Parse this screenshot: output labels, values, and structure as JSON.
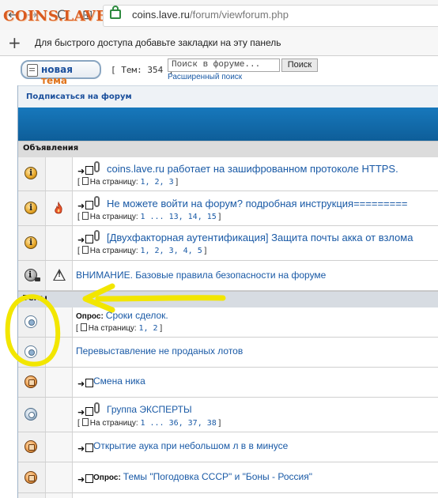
{
  "browser": {
    "back_symbol": "←",
    "forward_symbol": "→",
    "reload_symbol": "C",
    "apps_symbol": "⊞",
    "logo_overlay": "COINS.LAVE.RU",
    "url_host": "coins.lave.ru",
    "url_path": "/forum/viewforum.php",
    "bookmarks_hint": "Для быстрого доступа добавьте закладки на эту панель",
    "plus_symbol": "+"
  },
  "toolbar": {
    "new_topic_prefix": "новая ",
    "new_topic_accent": "тема",
    "topics_count": "[ Тем: 354 ]",
    "search_placeholder": "Поиск в форуме...",
    "search_button": "Поиск",
    "advanced_search": "Расширенный поиск"
  },
  "forum": {
    "subscribe": "Подписаться на форум",
    "announcements_header": "Объявления",
    "topics_header": "Темы"
  },
  "announcements": [
    {
      "title": "coins.lave.ru работает на зашифрованном протоколе HTTPS.",
      "pages_label": "На страницу:",
      "pages": "1, 2, 3"
    },
    {
      "title": "Не можете войти на форум? подробная инструкция=========",
      "pages_label": "На страницу:",
      "pages": "1 ... 13, 14, 15"
    },
    {
      "title": "[Двухфакторная аутентификация] Защита почты акка от взлома",
      "pages_label": "На страницу:",
      "pages": "1, 2, 3, 4, 5"
    },
    {
      "title": "ВНИМАНИЕ. Базовые правила безопасности на форуме"
    }
  ],
  "topics": [
    {
      "poll_label": "Опрос:",
      "title": "Сроки сделок.",
      "pages_label": "На страницу:",
      "pages": "1, 2"
    },
    {
      "title": "Перевыставление не проданых лотов"
    },
    {
      "title": "Смена ника"
    },
    {
      "title": "Группа ЭКСПЕРТЫ",
      "pages_label": "На страницу:",
      "pages": "1 ... 36, 37, 38"
    },
    {
      "title": "Открытие аука при небольшом л в в минусе"
    },
    {
      "poll_label": "Опрос:",
      "title": "Темы \"Погодовка СССР\" и \"Боны - Россия\""
    }
  ],
  "colors": {
    "link": "#1a5aa6",
    "brand_orange": "#d95a1f",
    "annotation_yellow": "#f2e600",
    "header_blue": "#0e5e99"
  }
}
